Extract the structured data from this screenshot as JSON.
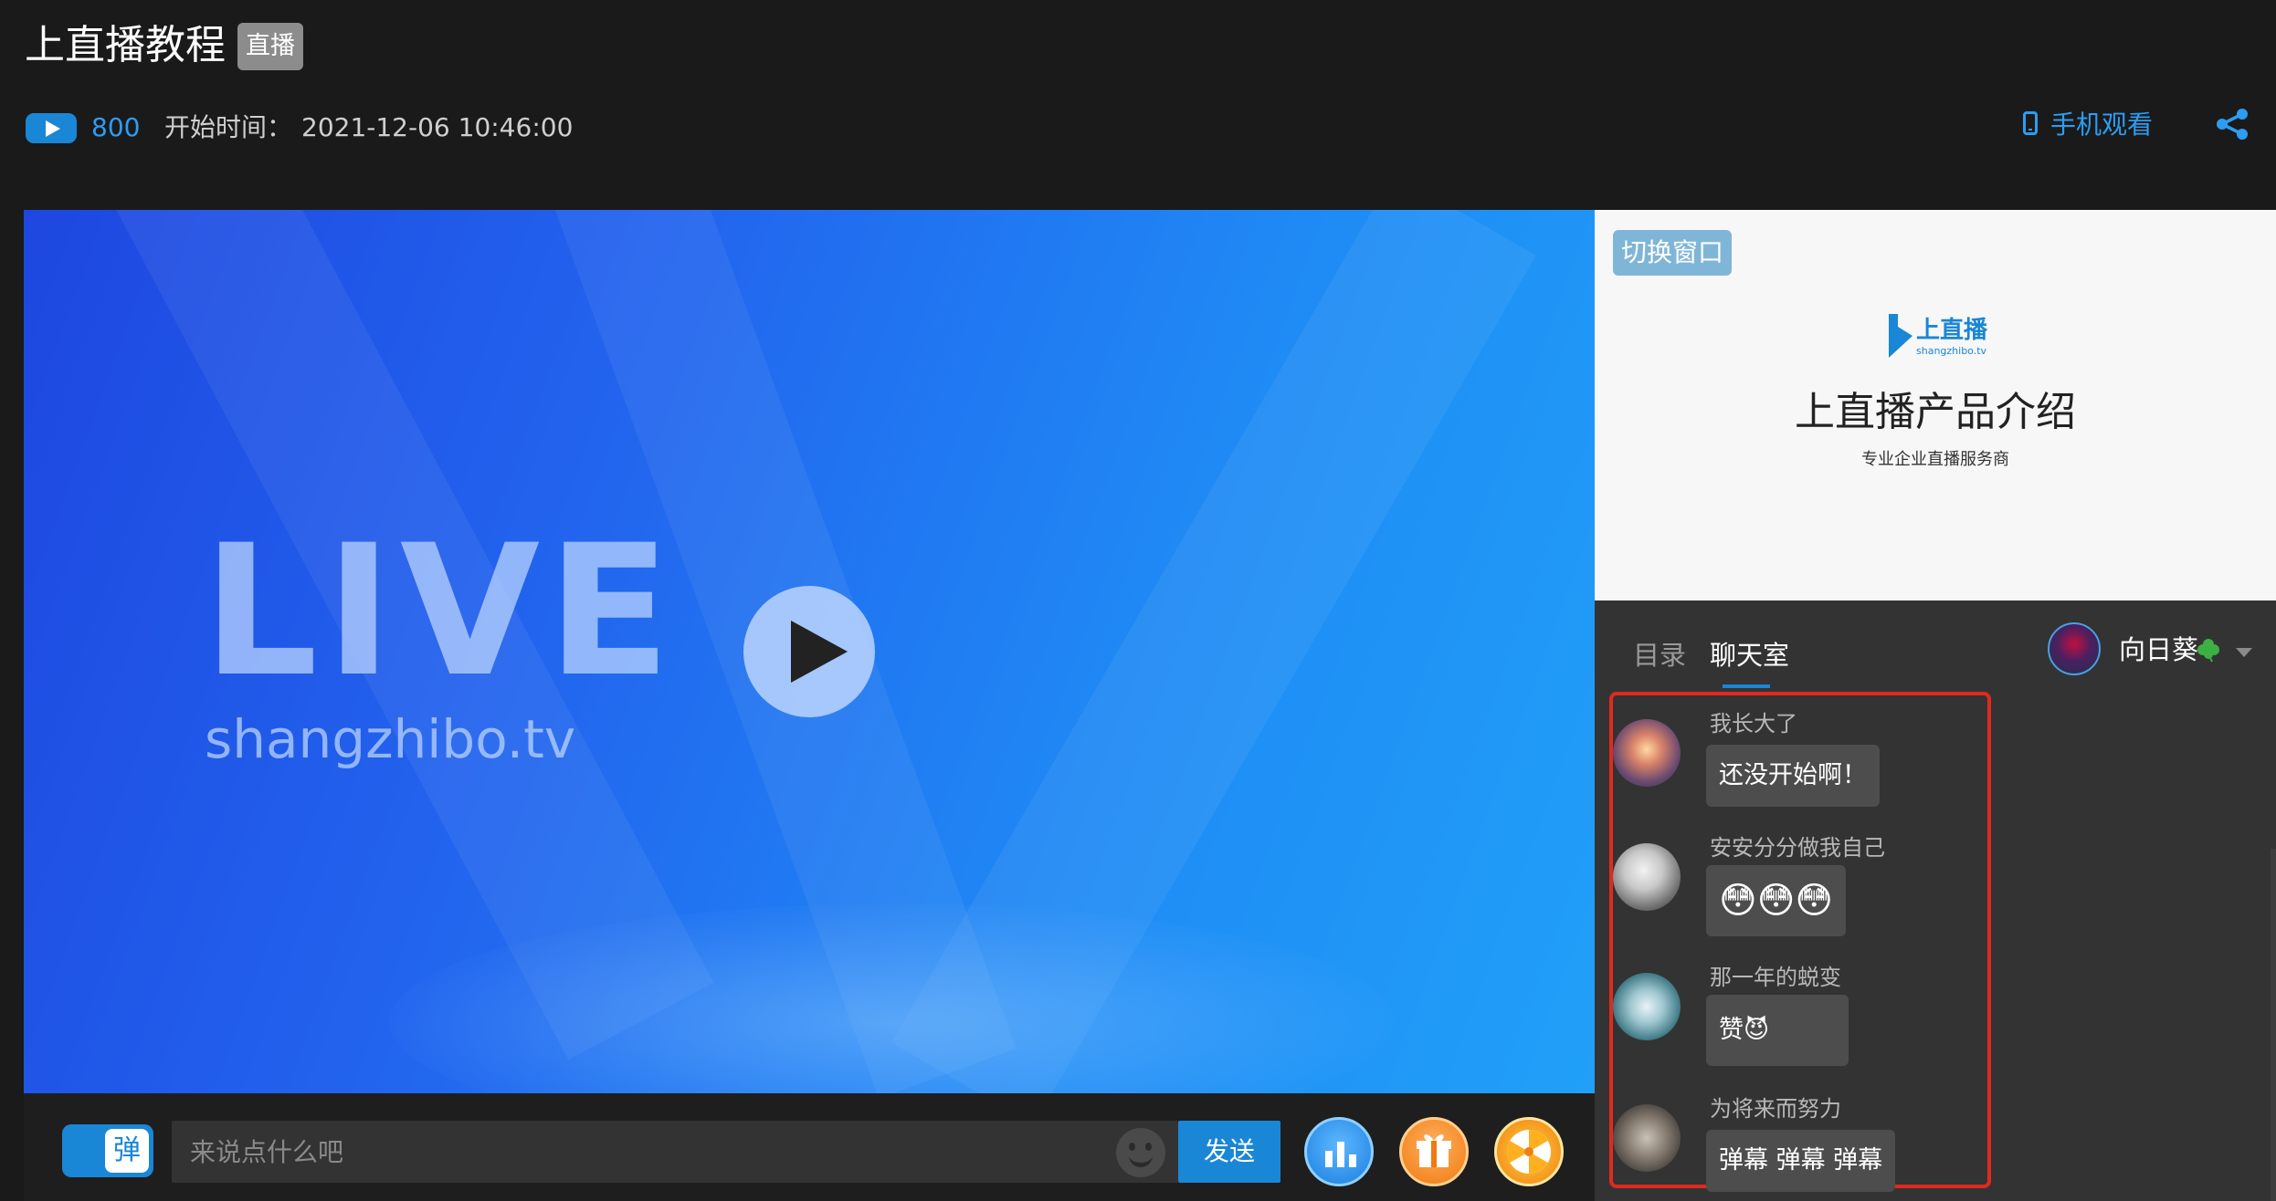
{
  "header": {
    "title": "上直播教程",
    "live_badge": "直播",
    "view_count": "800",
    "start_label": "开始时间：",
    "start_time": "2021-12-06 10:46:00",
    "mobile_watch": "手机观看"
  },
  "video": {
    "live_text": "LIVE",
    "site_text": "shangzhibo.tv"
  },
  "bottom_bar": {
    "danmaku_toggle_label": "弹",
    "input_placeholder": "来说点什么吧",
    "send_label": "发送"
  },
  "slide": {
    "switch_window": "切换窗口",
    "logo_text": "上直播",
    "logo_sub": "shangzhibo.tv",
    "title": "上直播产品介绍",
    "subtitle": "专业企业直播服务商"
  },
  "chat": {
    "tabs": [
      {
        "label": "目录",
        "active": false
      },
      {
        "label": "聊天室",
        "active": true
      }
    ],
    "current_user": "向日葵",
    "messages": [
      {
        "nick": "我长大了",
        "text": "还没开始啊！"
      },
      {
        "nick": "安安分分做我自己",
        "text": "😳😳😳"
      },
      {
        "nick": "那一年的蜕变",
        "text": "赞😈"
      },
      {
        "nick": "为将来而努力",
        "text": "弹幕 弹幕 弹幕"
      }
    ]
  },
  "colors": {
    "accent": "#1a86d6",
    "highlight": "#e02a1e",
    "background": "#1a1a1a",
    "panel": "#333333"
  }
}
